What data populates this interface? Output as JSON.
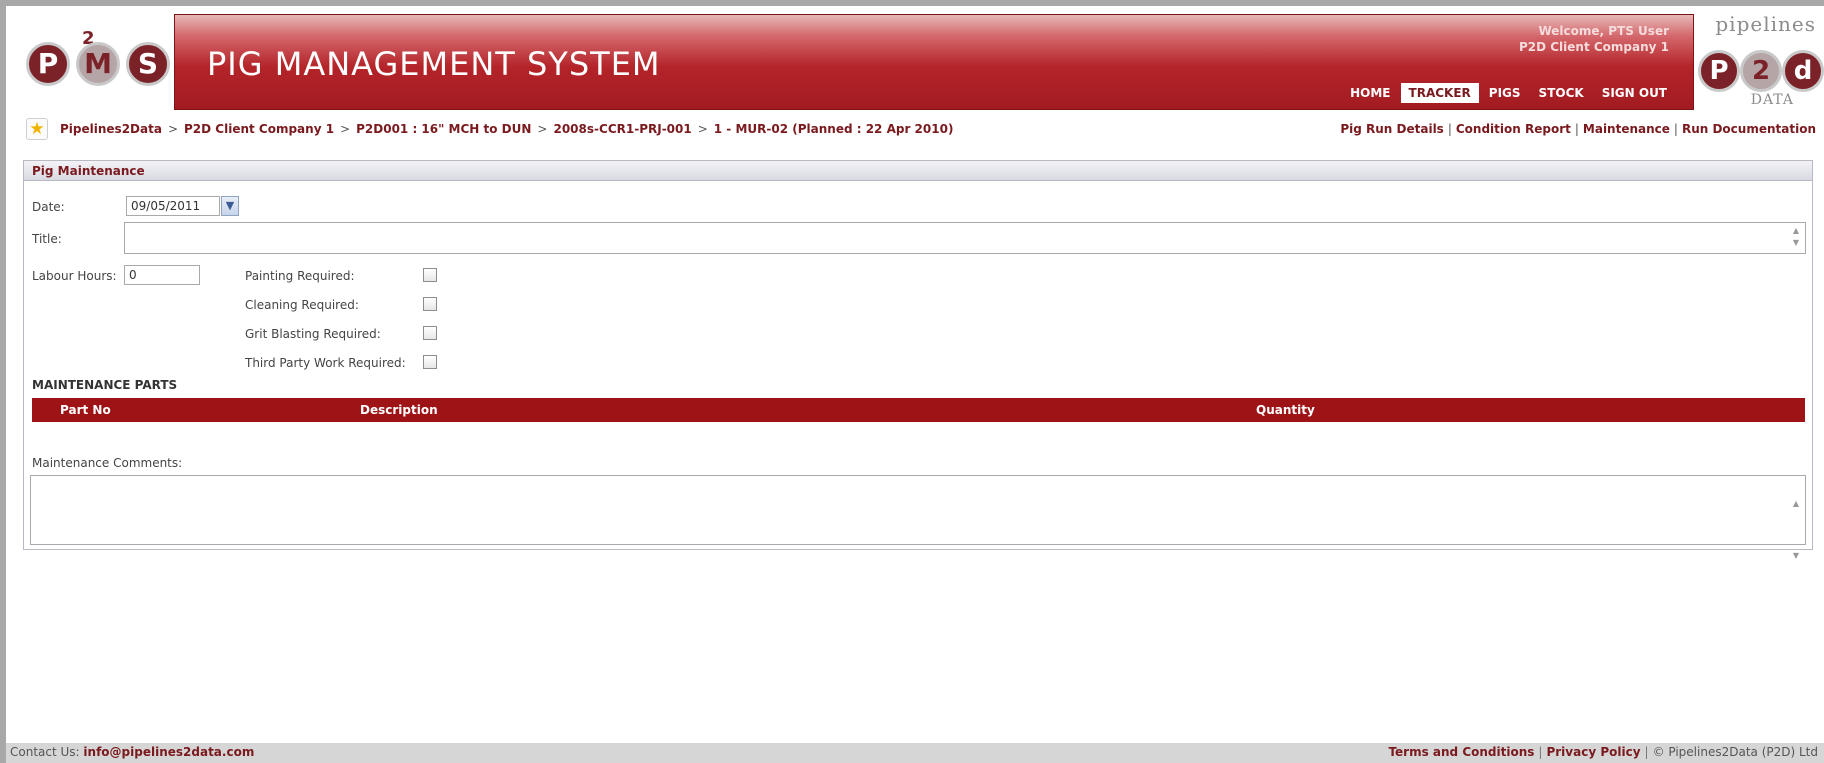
{
  "header": {
    "logo_left": {
      "letters": [
        "P",
        "M",
        "S"
      ],
      "superscript": "2"
    },
    "title": "PIG MANAGEMENT SYSTEM",
    "welcome": "Welcome, PTS User",
    "company": "P2D Client Company 1",
    "nav": [
      "HOME",
      "TRACKER",
      "PIGS",
      "STOCK",
      "SIGN OUT"
    ],
    "active_nav": "TRACKER",
    "logo_right": {
      "top": "pipelines",
      "letters": [
        "P",
        "2",
        "d"
      ],
      "bottom": "DATA"
    }
  },
  "breadcrumb": {
    "items": [
      "Pipelines2Data",
      "P2D Client Company 1",
      "P2D001 : 16\" MCH to DUN",
      "2008s-CCR1-PRJ-001",
      "1 - MUR-02 (Planned : 22 Apr 2010)"
    ],
    "separator": ">"
  },
  "sublinks": [
    "Pig Run Details",
    "Condition Report",
    "Maintenance",
    "Run Documentation"
  ],
  "panel": {
    "title": "Pig Maintenance",
    "date_label": "Date:",
    "date_value": "09/05/2011",
    "title_label": "Title:",
    "title_value": "",
    "labour_label": "Labour Hours:",
    "labour_value": "0",
    "checkboxes": [
      {
        "label": "Painting Required:",
        "checked": false
      },
      {
        "label": "Cleaning Required:",
        "checked": false
      },
      {
        "label": "Grit Blasting Required:",
        "checked": false
      },
      {
        "label": "Third Party Work Required:",
        "checked": false
      }
    ],
    "parts_title": "MAINTENANCE PARTS",
    "parts_columns": [
      "Part No",
      "Description",
      "Quantity"
    ],
    "comments_label": "Maintenance Comments:",
    "comments_value": ""
  },
  "footer": {
    "contact_label": "Contact Us:",
    "contact_email": "info@pipelines2data.com",
    "terms": "Terms and Conditions",
    "privacy": "Privacy Policy",
    "copyright": "© Pipelines2Data (P2D) Ltd"
  },
  "colors": {
    "brand_red": "#9e1316",
    "link": "#7a1a1e"
  }
}
